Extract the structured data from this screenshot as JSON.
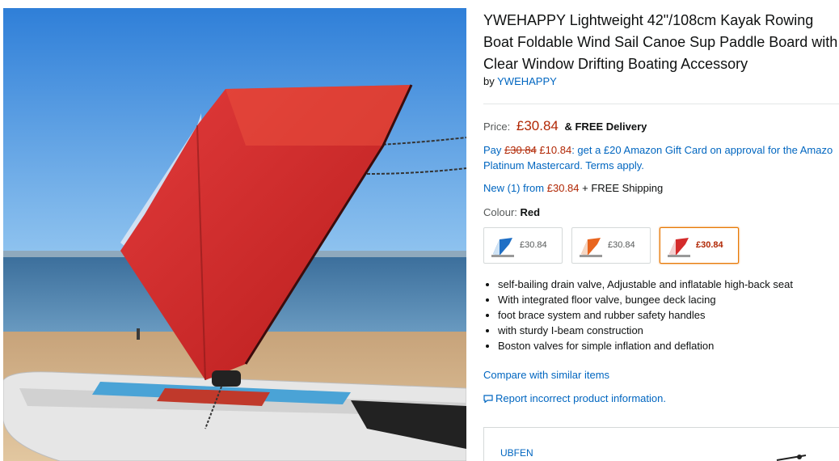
{
  "product": {
    "title": "YWEHAPPY Lightweight 42\"/108cm Kayak Rowing Boat Foldable Wind Sail Canoe Sup Paddle Board with Clear Window Drifting Boating Accessory",
    "by_prefix": "by",
    "brand": "YWEHAPPY"
  },
  "price": {
    "label": "Price:",
    "amount": "£30.84",
    "delivery": "& FREE Delivery"
  },
  "promo": {
    "pay": "Pay",
    "old_price": "£30.84",
    "new_price": "£10.84",
    "line1_rest": ": get a £20 Amazon Gift Card on approval for the Amazo",
    "line2": "Platinum Mastercard. Terms apply."
  },
  "offers": {
    "new_link": "New (1) from",
    "price": "£30.84",
    "shipping": "+ FREE Shipping"
  },
  "colour": {
    "label": "Colour:",
    "value": "Red",
    "options": [
      {
        "price": "£30.84",
        "color": "#1f6fc5",
        "selected": false
      },
      {
        "price": "£30.84",
        "color": "#e8651f",
        "selected": false
      },
      {
        "price": "£30.84",
        "color": "#d42b2b",
        "selected": true
      }
    ]
  },
  "bullets": [
    "self-bailing drain valve, Adjustable and inflatable high-back seat",
    "With integrated floor valve, bungee deck lacing",
    "foot brace system and rubber safety handles",
    "with sturdy I-beam construction",
    "Boston valves for simple inflation and deflation"
  ],
  "links": {
    "compare": "Compare with similar items",
    "report": "Report incorrect product information."
  },
  "seller_panel": {
    "brand": "UBFEN"
  },
  "colors": {
    "link": "#0066c0",
    "price": "#b12704",
    "sail": "#d42b2b",
    "sky": "#3f8ee0",
    "sea": "#2a5f8f",
    "sand": "#d8b98c"
  }
}
